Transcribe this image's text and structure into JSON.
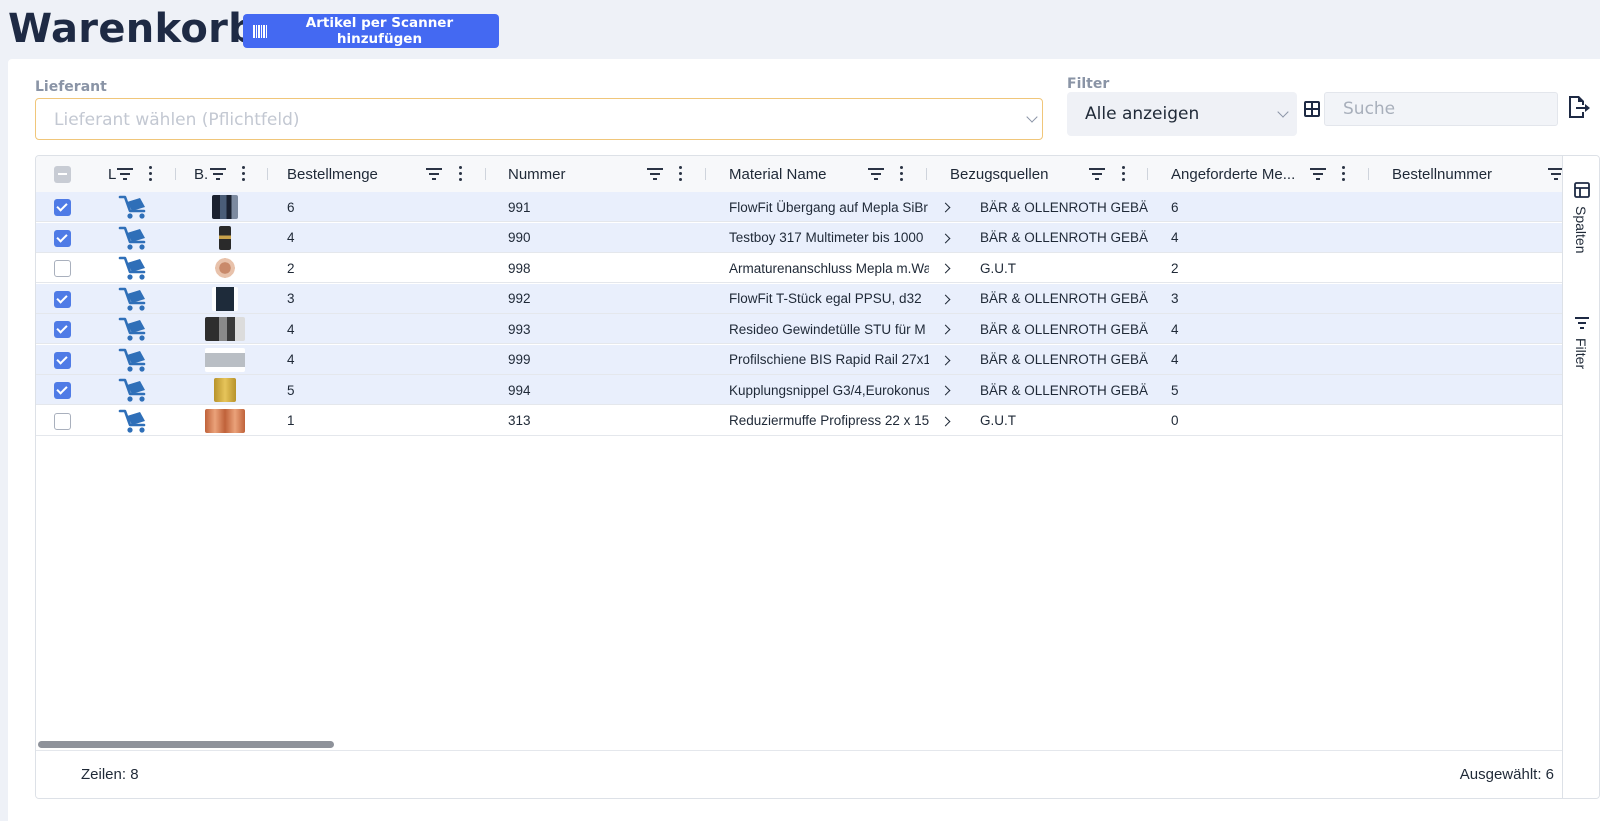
{
  "page_title": "Warenkorb",
  "scanner_button_label": "Artikel per Scanner hinzufügen",
  "supplier": {
    "label": "Lieferant",
    "placeholder": "Lieferant wählen (Pflichtfeld)"
  },
  "filter": {
    "label": "Filter",
    "value": "Alle anzeigen"
  },
  "search": {
    "placeholder": "Suche"
  },
  "columns": {
    "l": "L",
    "b": "B.",
    "bestellmenge": "Bestellmenge",
    "nummer": "Nummer",
    "material_name": "Material Name",
    "bezugsquellen": "Bezugsquellen",
    "angeforderte": "Angeforderte Me...",
    "bestellnummer": "Bestellnummer"
  },
  "rows": [
    {
      "selected": true,
      "bestellmenge": "6",
      "nummer": "991",
      "material_name": "FlowFit Übergang auf Mepla SiBr",
      "bezugsquelle": "BÄR & OLLENROTH GEBÄU",
      "angeforderte": "6"
    },
    {
      "selected": true,
      "bestellmenge": "4",
      "nummer": "990",
      "material_name": "Testboy 317 Multimeter bis 1000",
      "bezugsquelle": "BÄR & OLLENROTH GEBÄU",
      "angeforderte": "4"
    },
    {
      "selected": false,
      "bestellmenge": "2",
      "nummer": "998",
      "material_name": "Armaturenanschluss Mepla m.Wa",
      "bezugsquelle": "G.U.T",
      "angeforderte": "2"
    },
    {
      "selected": true,
      "bestellmenge": "3",
      "nummer": "992",
      "material_name": "FlowFit T-Stück egal PPSU, d32",
      "bezugsquelle": "BÄR & OLLENROTH GEBÄU",
      "angeforderte": "3"
    },
    {
      "selected": true,
      "bestellmenge": "4",
      "nummer": "993",
      "material_name": "Resideo Gewindetülle STU für M",
      "bezugsquelle": "BÄR & OLLENROTH GEBÄU",
      "angeforderte": "4"
    },
    {
      "selected": true,
      "bestellmenge": "4",
      "nummer": "999",
      "material_name": "Profilschiene BIS Rapid Rail 27x1",
      "bezugsquelle": "BÄR & OLLENROTH GEBÄU",
      "angeforderte": "4"
    },
    {
      "selected": true,
      "bestellmenge": "5",
      "nummer": "994",
      "material_name": "Kupplungsnippel G3/4,Eurokonus",
      "bezugsquelle": "BÄR & OLLENROTH GEBÄU",
      "angeforderte": "5"
    },
    {
      "selected": false,
      "bestellmenge": "1",
      "nummer": "313",
      "material_name": "Reduziermuffe Profipress 22 x 15",
      "bezugsquelle": "G.U.T",
      "angeforderte": "0"
    }
  ],
  "side_panel": {
    "columns_label": "Spalten",
    "filter_label": "Filter"
  },
  "footer": {
    "rows_text": "Zeilen: 8",
    "selected_text": "Ausgewählt: 6"
  },
  "colors": {
    "accent": "#4469f2",
    "selected_row": "#e9effc",
    "title": "#1e2a44"
  }
}
